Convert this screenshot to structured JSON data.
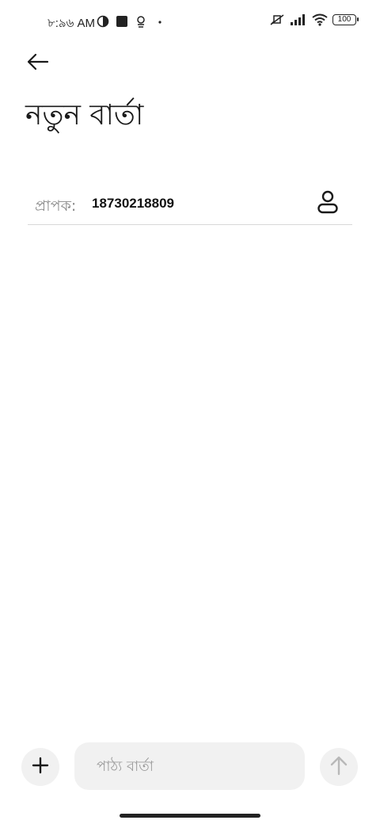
{
  "status_bar": {
    "time": "৮:৯৬ AM",
    "left_icons": [
      "half-circle-icon",
      "square-notification-icon",
      "location-pin-icon",
      "dot-icon"
    ],
    "right_icons": [
      "mute-icon",
      "signal-icon",
      "wifi-icon"
    ],
    "battery": "100"
  },
  "header": {
    "back_icon": "arrow-left-icon",
    "title": "নতুন বার্তা"
  },
  "recipient": {
    "label": "প্রাপক:",
    "value": "18730218809",
    "contact_icon": "person-icon"
  },
  "composer": {
    "attach_icon": "plus-icon",
    "placeholder": "পাঠ্য বার্তা",
    "value": "",
    "send_icon": "arrow-up-icon"
  }
}
